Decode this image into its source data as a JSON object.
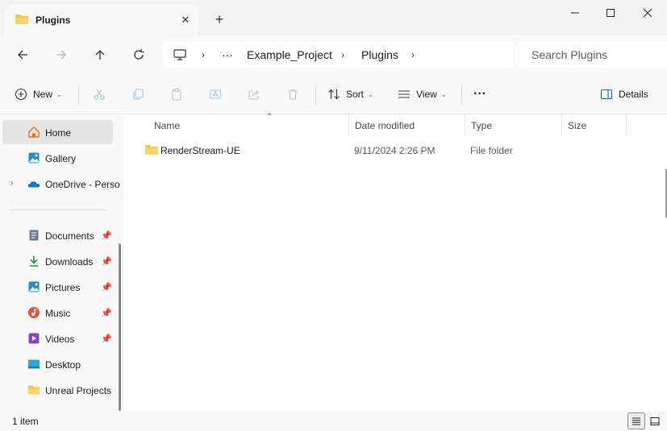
{
  "window": {
    "tab_title": "Plugins",
    "tab_close": "✕",
    "new_tab": "+"
  },
  "address": {
    "more": "···",
    "breadcrumb": [
      "Example_Project",
      "Plugins"
    ],
    "separator": "›",
    "search_placeholder": "Search Plugins"
  },
  "commandbar": {
    "new_label": "New",
    "sort_label": "Sort",
    "view_label": "View",
    "more": "···",
    "details_label": "Details",
    "caret": "⌄"
  },
  "sidebar": {
    "items": [
      {
        "label": "Home",
        "icon": "home-icon",
        "selected": true
      },
      {
        "label": "Gallery",
        "icon": "gallery-icon"
      },
      {
        "label": "OneDrive - Perso",
        "icon": "onedrive-icon",
        "expandable": true
      },
      {
        "label": "Documents",
        "icon": "documents-icon",
        "pinned": true
      },
      {
        "label": "Downloads",
        "icon": "downloads-icon",
        "pinned": true
      },
      {
        "label": "Pictures",
        "icon": "pictures-icon",
        "pinned": true
      },
      {
        "label": "Music",
        "icon": "music-icon",
        "pinned": true
      },
      {
        "label": "Videos",
        "icon": "videos-icon",
        "pinned": true
      },
      {
        "label": "Desktop",
        "icon": "desktop-icon"
      },
      {
        "label": "Unreal Projects",
        "icon": "folder-icon"
      }
    ],
    "pin_glyph": "📌",
    "expand_glyph": "›"
  },
  "content": {
    "columns": [
      "Name",
      "Date modified",
      "Type",
      "Size"
    ],
    "sort_indicator": "⌃",
    "rows": [
      {
        "name": "RenderStream-UE",
        "date_modified": "9/11/2024 2:26 PM",
        "type": "File folder",
        "size": ""
      }
    ]
  },
  "status": {
    "item_count": "1 item"
  },
  "colors": {
    "folder": "#f8c443",
    "accent": "#0067c0",
    "selected_bg": "#e4e4e4"
  }
}
